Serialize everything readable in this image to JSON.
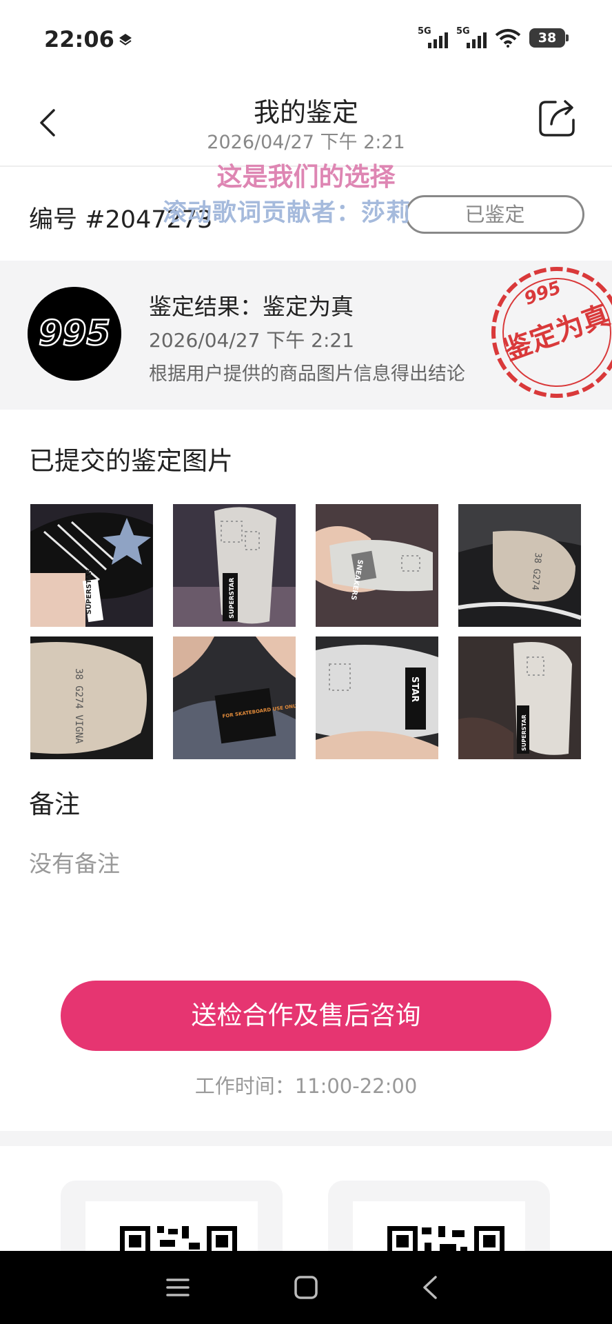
{
  "status_bar": {
    "time": "22:06",
    "network_1": "5G",
    "network_2": "5G",
    "battery": "38",
    "icons": [
      "layers-icon",
      "signal-icon",
      "signal-icon",
      "wifi-icon",
      "battery-icon"
    ]
  },
  "header": {
    "title": "我的鉴定",
    "subtitle": "2026/04/27 下午 2:21",
    "back_icon": "chevron-left-icon",
    "share_icon": "share-icon"
  },
  "overlay": {
    "line1": "这是我们的选择",
    "line2": "滚动歌词贡献者：莎莉"
  },
  "order": {
    "id": "编号 #2047273",
    "status": "已鉴定"
  },
  "result": {
    "title": "鉴定结果：鉴定为真",
    "time": "2026/04/27 下午 2:21",
    "description": "根据用户提供的商品图片信息得出结论",
    "stamp_text": "鉴定为真",
    "stamp_brand": "995",
    "logo_text": "995",
    "stamp_color": "#d9393a"
  },
  "images_section": {
    "title": "已提交的鉴定图片",
    "images": [
      {
        "caption": "SUPERSTAR"
      },
      {
        "caption": "SUPERSTAR"
      },
      {
        "caption": "SNEAKERS"
      },
      {
        "caption": "38 G274"
      },
      {
        "caption": "38 G274 VIGNA"
      },
      {
        "caption": "FOR SKATEBOARD USE ONLY"
      },
      {
        "caption": "STAR"
      },
      {
        "caption": "SUPERSTAR"
      }
    ]
  },
  "remarks": {
    "title": "备注",
    "empty_text": "没有备注"
  },
  "consult": {
    "button_label": "送检合作及售后咨询",
    "work_hours": "工作时间：11:00-22:00",
    "accent": "#e63571"
  },
  "nav_bar": {
    "icons": [
      "menu-icon",
      "home-square-icon",
      "back-triangle-icon"
    ]
  }
}
